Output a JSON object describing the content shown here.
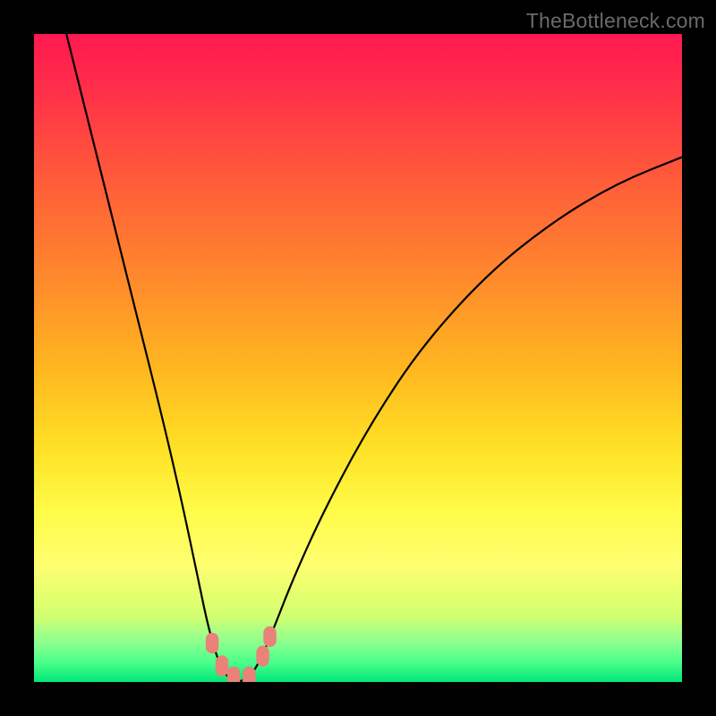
{
  "watermark": "TheBottleneck.com",
  "chart_data": {
    "type": "line",
    "title": "",
    "xlabel": "",
    "ylabel": "",
    "xlim": [
      0,
      100
    ],
    "ylim": [
      0,
      100
    ],
    "grid": false,
    "legend": false,
    "series": [
      {
        "name": "bottleneck-curve",
        "color": "#000000",
        "points": [
          {
            "x": 5.0,
            "y": 100.0
          },
          {
            "x": 8.0,
            "y": 88.0
          },
          {
            "x": 12.0,
            "y": 72.0
          },
          {
            "x": 16.0,
            "y": 56.0
          },
          {
            "x": 20.0,
            "y": 40.0
          },
          {
            "x": 23.0,
            "y": 27.0
          },
          {
            "x": 25.5,
            "y": 15.0
          },
          {
            "x": 27.0,
            "y": 8.0
          },
          {
            "x": 28.5,
            "y": 3.0
          },
          {
            "x": 30.0,
            "y": 0.5
          },
          {
            "x": 31.5,
            "y": 0.0
          },
          {
            "x": 33.0,
            "y": 0.5
          },
          {
            "x": 34.5,
            "y": 2.5
          },
          {
            "x": 36.5,
            "y": 7.0
          },
          {
            "x": 40.0,
            "y": 16.0
          },
          {
            "x": 45.0,
            "y": 27.0
          },
          {
            "x": 52.0,
            "y": 40.0
          },
          {
            "x": 60.0,
            "y": 52.0
          },
          {
            "x": 70.0,
            "y": 63.0
          },
          {
            "x": 80.0,
            "y": 71.0
          },
          {
            "x": 90.0,
            "y": 77.0
          },
          {
            "x": 100.0,
            "y": 81.0
          }
        ]
      }
    ],
    "markers": {
      "color": "#e98278",
      "points": [
        {
          "x": 27.5,
          "y": 6.0,
          "w": 2.0,
          "h": 3.2
        },
        {
          "x": 29.0,
          "y": 2.5,
          "w": 2.0,
          "h": 3.2
        },
        {
          "x": 30.8,
          "y": 0.8,
          "w": 2.0,
          "h": 3.2
        },
        {
          "x": 33.2,
          "y": 0.8,
          "w": 2.0,
          "h": 3.2
        },
        {
          "x": 35.3,
          "y": 4.0,
          "w": 2.0,
          "h": 3.2
        },
        {
          "x": 36.4,
          "y": 7.0,
          "w": 2.0,
          "h": 3.2
        }
      ]
    },
    "background_gradient": {
      "stops": [
        {
          "pos": 0.0,
          "color": "#ff1850"
        },
        {
          "pos": 0.22,
          "color": "#ff5a3a"
        },
        {
          "pos": 0.52,
          "color": "#ffb81f"
        },
        {
          "pos": 0.74,
          "color": "#fffc4a"
        },
        {
          "pos": 0.92,
          "color": "#acff85"
        },
        {
          "pos": 1.0,
          "color": "#00e676"
        }
      ]
    }
  }
}
